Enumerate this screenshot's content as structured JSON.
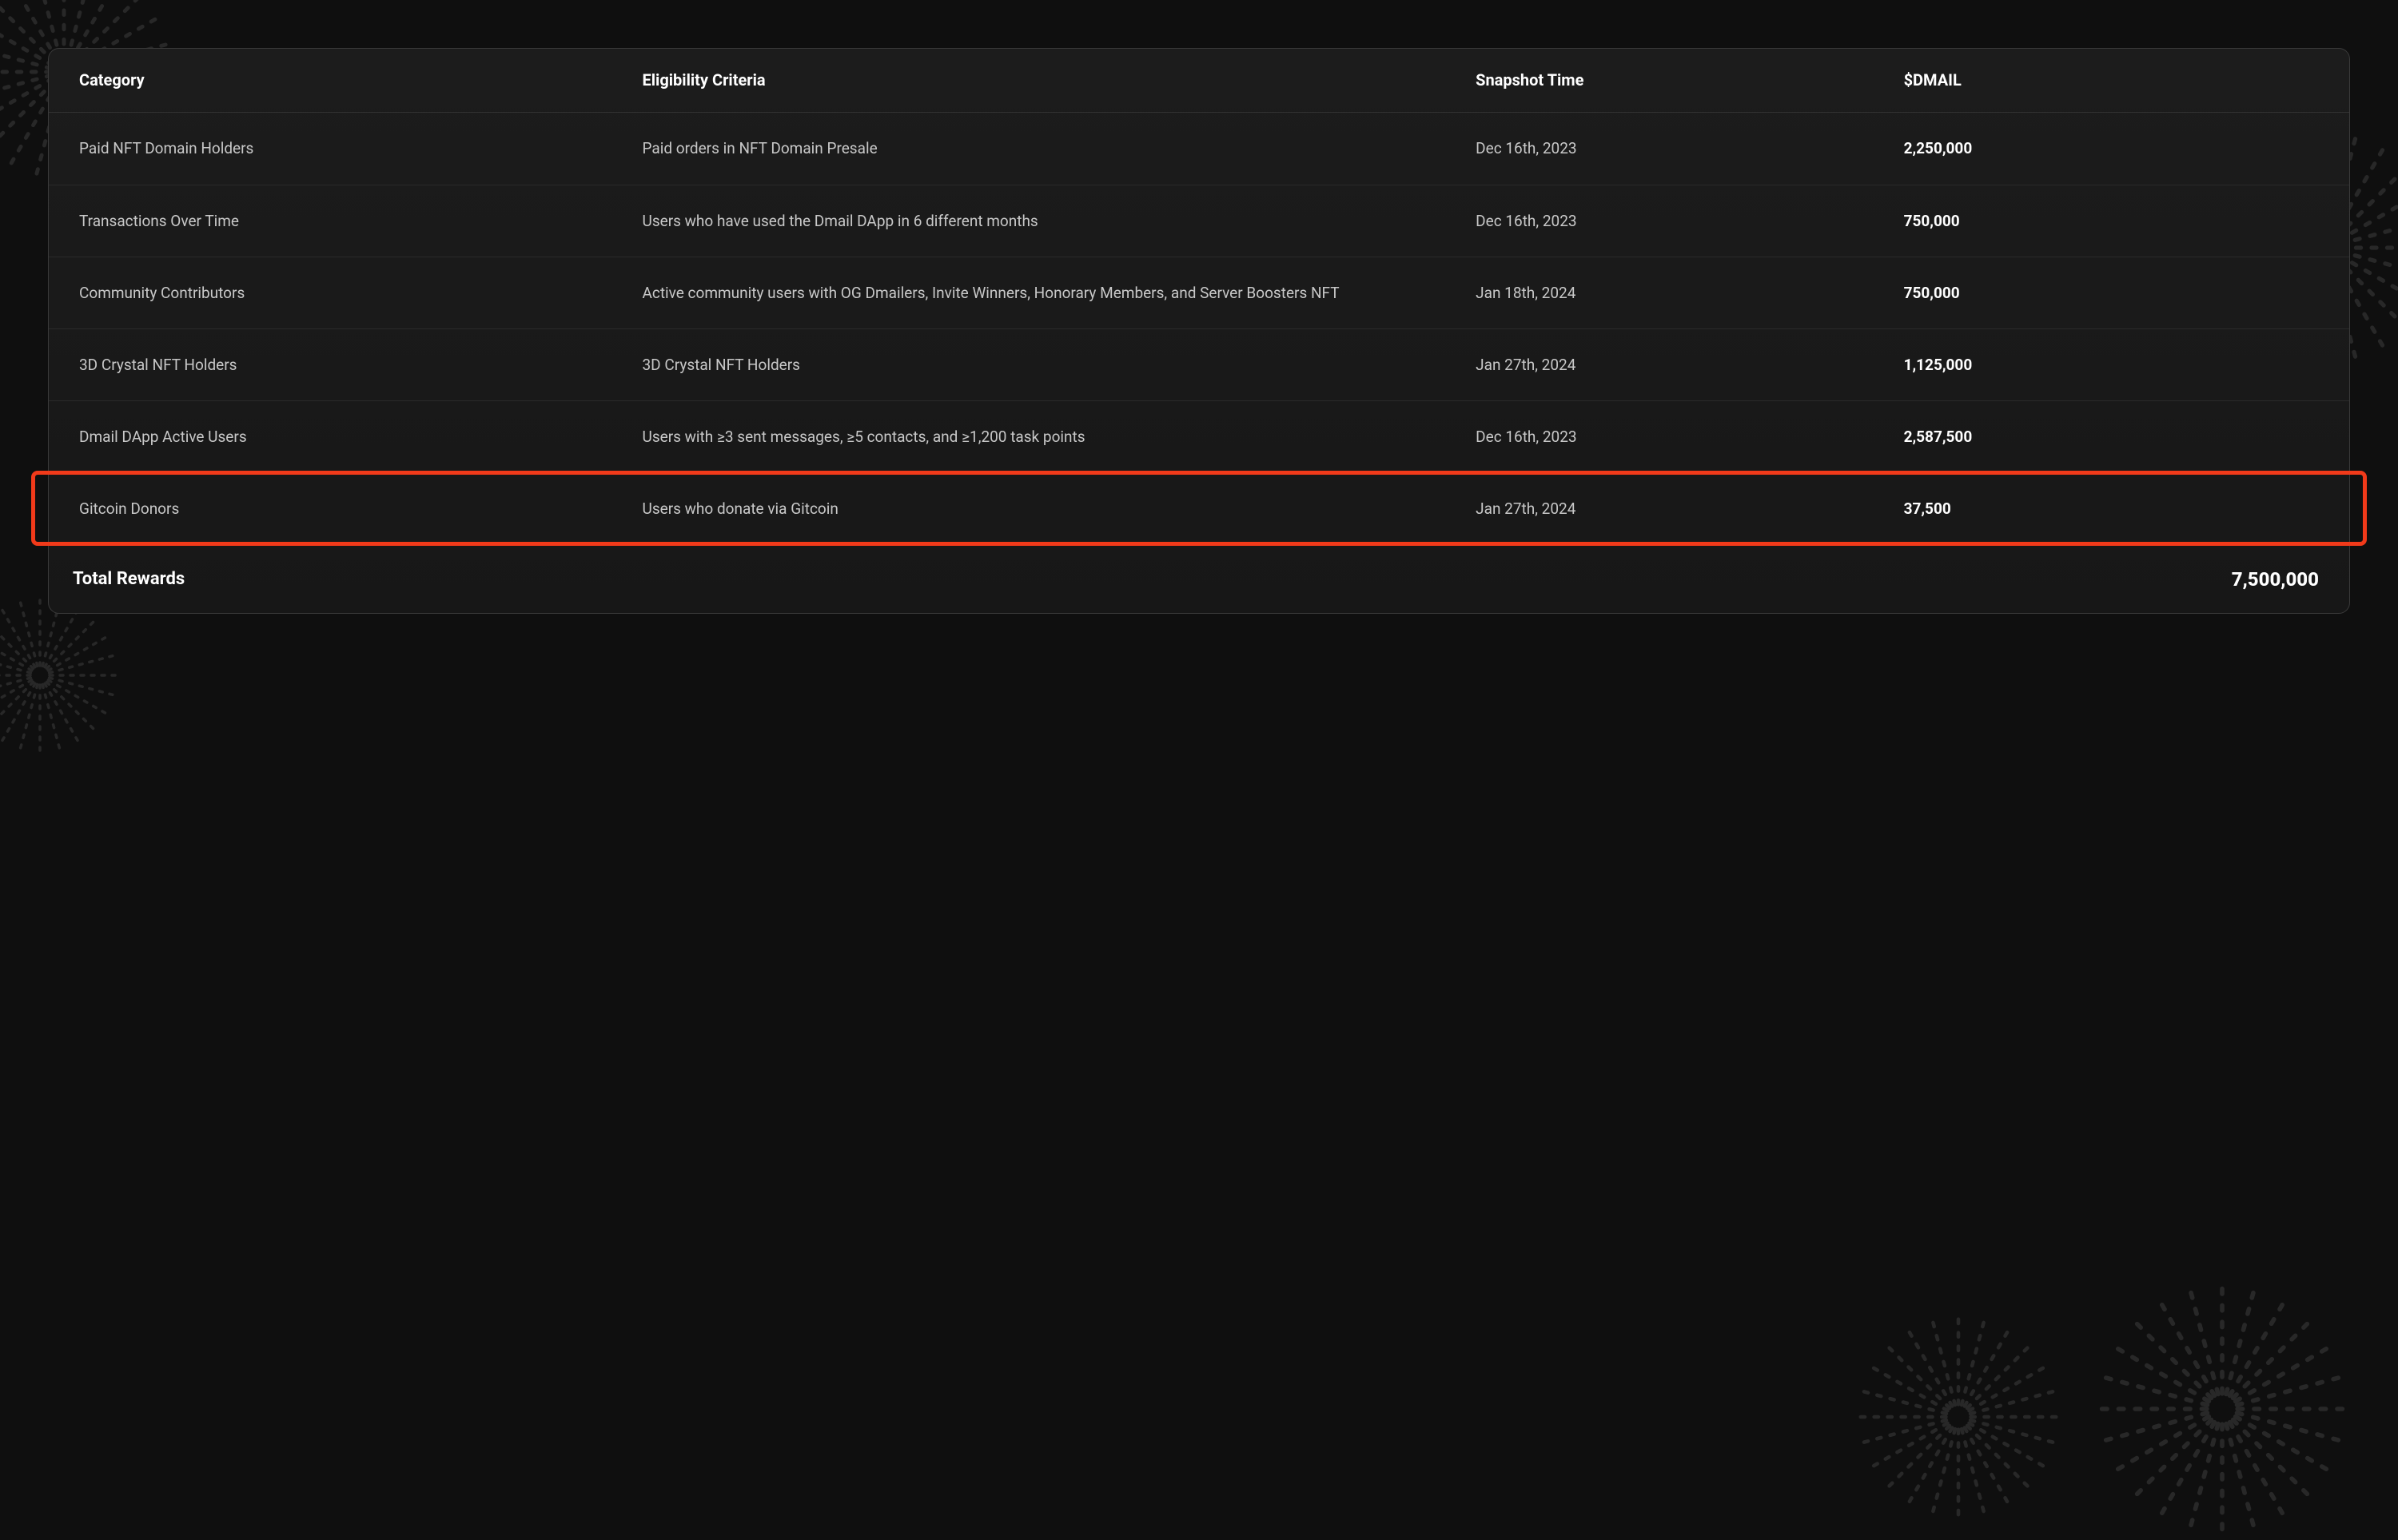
{
  "table": {
    "headers": {
      "category": "Category",
      "criteria": "Eligibility Criteria",
      "snapshot": "Snapshot Time",
      "dmail": "$DMAIL"
    },
    "rows": [
      {
        "category": "Paid NFT Domain Holders",
        "criteria": "Paid orders in NFT Domain Presale",
        "snapshot": "Dec 16th, 2023",
        "dmail": "2,250,000"
      },
      {
        "category": "Transactions Over Time",
        "criteria": "Users who have used the Dmail DApp in 6 different months",
        "snapshot": "Dec 16th, 2023",
        "dmail": "750,000"
      },
      {
        "category": "Community Contributors",
        "criteria": "Active community users with OG Dmailers, Invite Winners, Honorary Members, and Server Boosters NFT",
        "snapshot": "Jan 18th, 2024",
        "dmail": "750,000"
      },
      {
        "category": "3D Crystal NFT Holders",
        "criteria": "3D Crystal NFT Holders",
        "snapshot": "Jan 27th, 2024",
        "dmail": "1,125,000"
      },
      {
        "category": "Dmail DApp Active Users",
        "criteria": "Users with ≥3 sent messages, ≥5 contacts, and ≥1,200 task points",
        "snapshot": "Dec 16th, 2023",
        "dmail": "2,587,500"
      },
      {
        "category": "Gitcoin Donors",
        "criteria": "Users who donate via Gitcoin",
        "snapshot": "Jan 27th, 2024",
        "dmail": "37,500"
      }
    ],
    "footer": {
      "label": "Total Rewards",
      "value": "7,500,000"
    },
    "highlighted_row_index": 5
  }
}
